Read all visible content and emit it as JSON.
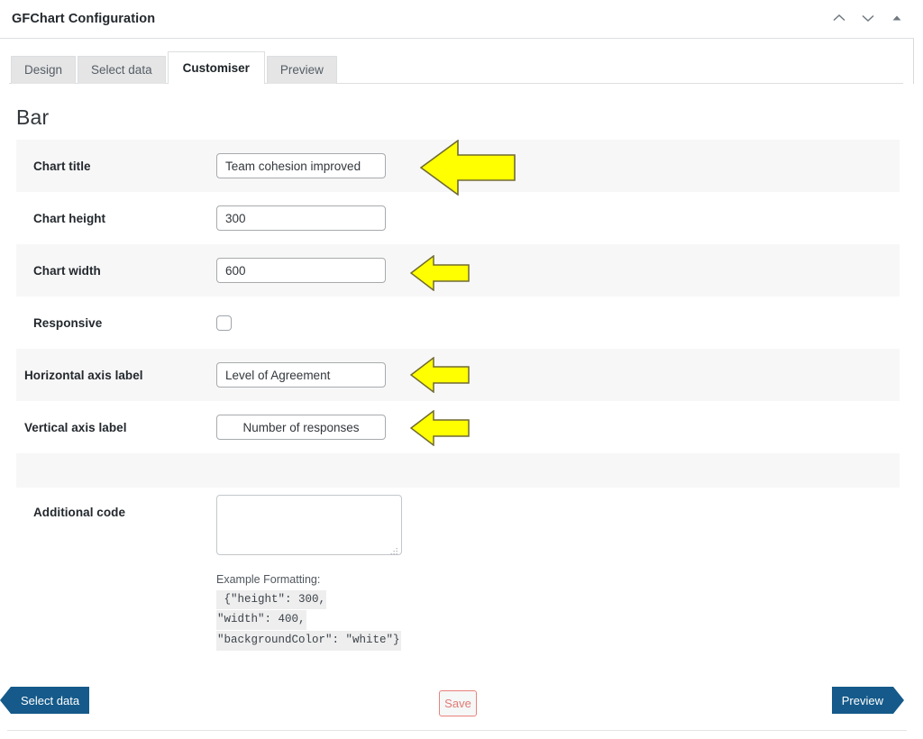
{
  "window": {
    "title": "GFChart Configuration",
    "controls": [
      {
        "name": "collapse-up-icon",
        "glyph": "chevron-up"
      },
      {
        "name": "expand-down-icon",
        "glyph": "chevron-down"
      },
      {
        "name": "minimize-icon",
        "glyph": "triangle-up"
      }
    ]
  },
  "tabs": [
    {
      "label": "Design",
      "active": false
    },
    {
      "label": "Select data",
      "active": false
    },
    {
      "label": "Customiser",
      "active": true
    },
    {
      "label": "Preview",
      "active": false
    }
  ],
  "section": {
    "heading": "Bar"
  },
  "fields": {
    "chart_title": {
      "label": "Chart title",
      "value": "Team cohesion improved",
      "placeholder": ""
    },
    "chart_height": {
      "label": "Chart height",
      "value": "300",
      "placeholder": ""
    },
    "chart_width": {
      "label": "Chart width",
      "value": "600",
      "placeholder": ""
    },
    "responsive": {
      "label": "Responsive",
      "checked": false
    },
    "horizontal_axis_label": {
      "label": "Horizontal axis label",
      "value": "Level of Agreement",
      "placeholder": ""
    },
    "vertical_axis_label": {
      "label": "Vertical axis label",
      "value": "Number of responses",
      "placeholder": ""
    },
    "additional_code": {
      "label": "Additional code",
      "value": "",
      "placeholder": ""
    }
  },
  "example": {
    "title": "Example Formatting:",
    "lines": [
      " {\"height\": 300,",
      "\"width\": 400,",
      "\"backgroundColor\": \"white\"}"
    ]
  },
  "footer": {
    "prev_label": "Select data",
    "save_label": "Save",
    "next_label": "Preview"
  },
  "colors": {
    "nav_blue": "#155a8a",
    "save_border": "#e8827c",
    "save_text": "#e07b76",
    "annotation_yellow": "#ffff00",
    "annotation_outline": "#706a32",
    "row_stripe": "#f7f7f7"
  },
  "annotations": [
    {
      "name": "arrow-chart-title",
      "target": "Chart title"
    },
    {
      "name": "arrow-chart-width",
      "target": "Chart width"
    },
    {
      "name": "arrow-horizontal-axis-label",
      "target": "Horizontal axis label"
    },
    {
      "name": "arrow-vertical-axis-label",
      "target": "Vertical axis label"
    }
  ]
}
